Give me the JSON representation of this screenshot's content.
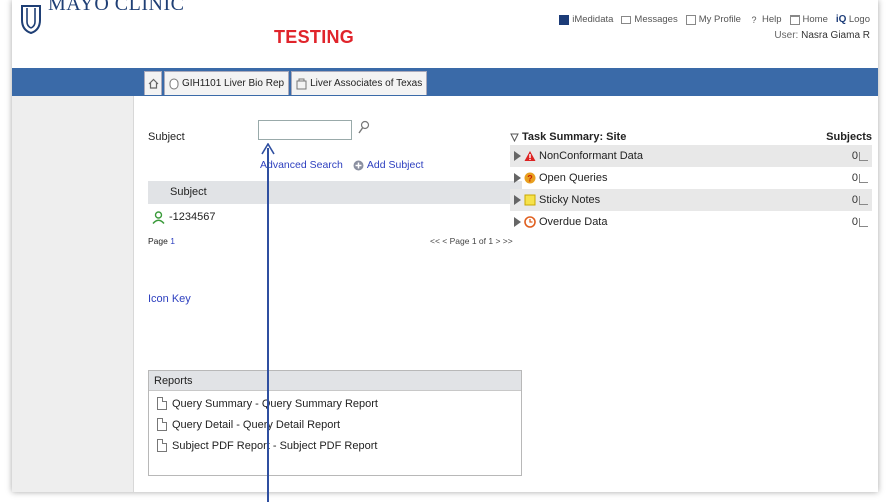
{
  "header": {
    "logo_text": "MAYO CLINIC",
    "environment": "TESTING",
    "links": [
      {
        "icon": "medidata-icon",
        "label": "iMedidata"
      },
      {
        "icon": "envelope-icon",
        "label": "Messages"
      },
      {
        "icon": "profile-icon",
        "label": "My Profile"
      },
      {
        "icon": "help-icon",
        "label": "Help"
      },
      {
        "icon": "home-icon",
        "label": "Home"
      },
      {
        "icon": "logout-icon",
        "label": "Logo"
      }
    ],
    "user_label": "User:",
    "user_name": "Nasra Giama R"
  },
  "breadcrumb": {
    "home_icon": "home-icon",
    "tabs": [
      {
        "icon": "study-icon",
        "label": "GIH1101 Liver Bio Rep"
      },
      {
        "icon": "site-icon",
        "label": "Liver Associates of Texas"
      }
    ]
  },
  "subject_search": {
    "label": "Subject",
    "value": "",
    "placeholder": "",
    "advanced_search": "Advanced Search",
    "add_subject": "Add Subject"
  },
  "subject_table": {
    "header": "Subject",
    "rows": [
      {
        "icon": "person-icon",
        "subject": "-1234567"
      }
    ],
    "page_label": "Page",
    "page_number": "1",
    "pager_text": "<< < Page 1 of 1 > >>"
  },
  "icon_key": "Icon Key",
  "reports": {
    "header": "Reports",
    "items": [
      "Query Summary - Query Summary Report",
      "Query Detail - Query Detail Report",
      "Subject PDF Report - Subject PDF Report"
    ]
  },
  "task_summary": {
    "title": "Task Summary: Site",
    "subjects_header": "Subjects",
    "rows": [
      {
        "icon": "warning-icon",
        "label": "NonConformant Data",
        "count": "0"
      },
      {
        "icon": "query-icon",
        "label": "Open Queries",
        "count": "0"
      },
      {
        "icon": "sticky-note-icon",
        "label": "Sticky Notes",
        "count": "0"
      },
      {
        "icon": "overdue-icon",
        "label": "Overdue Data",
        "count": "0"
      }
    ]
  }
}
